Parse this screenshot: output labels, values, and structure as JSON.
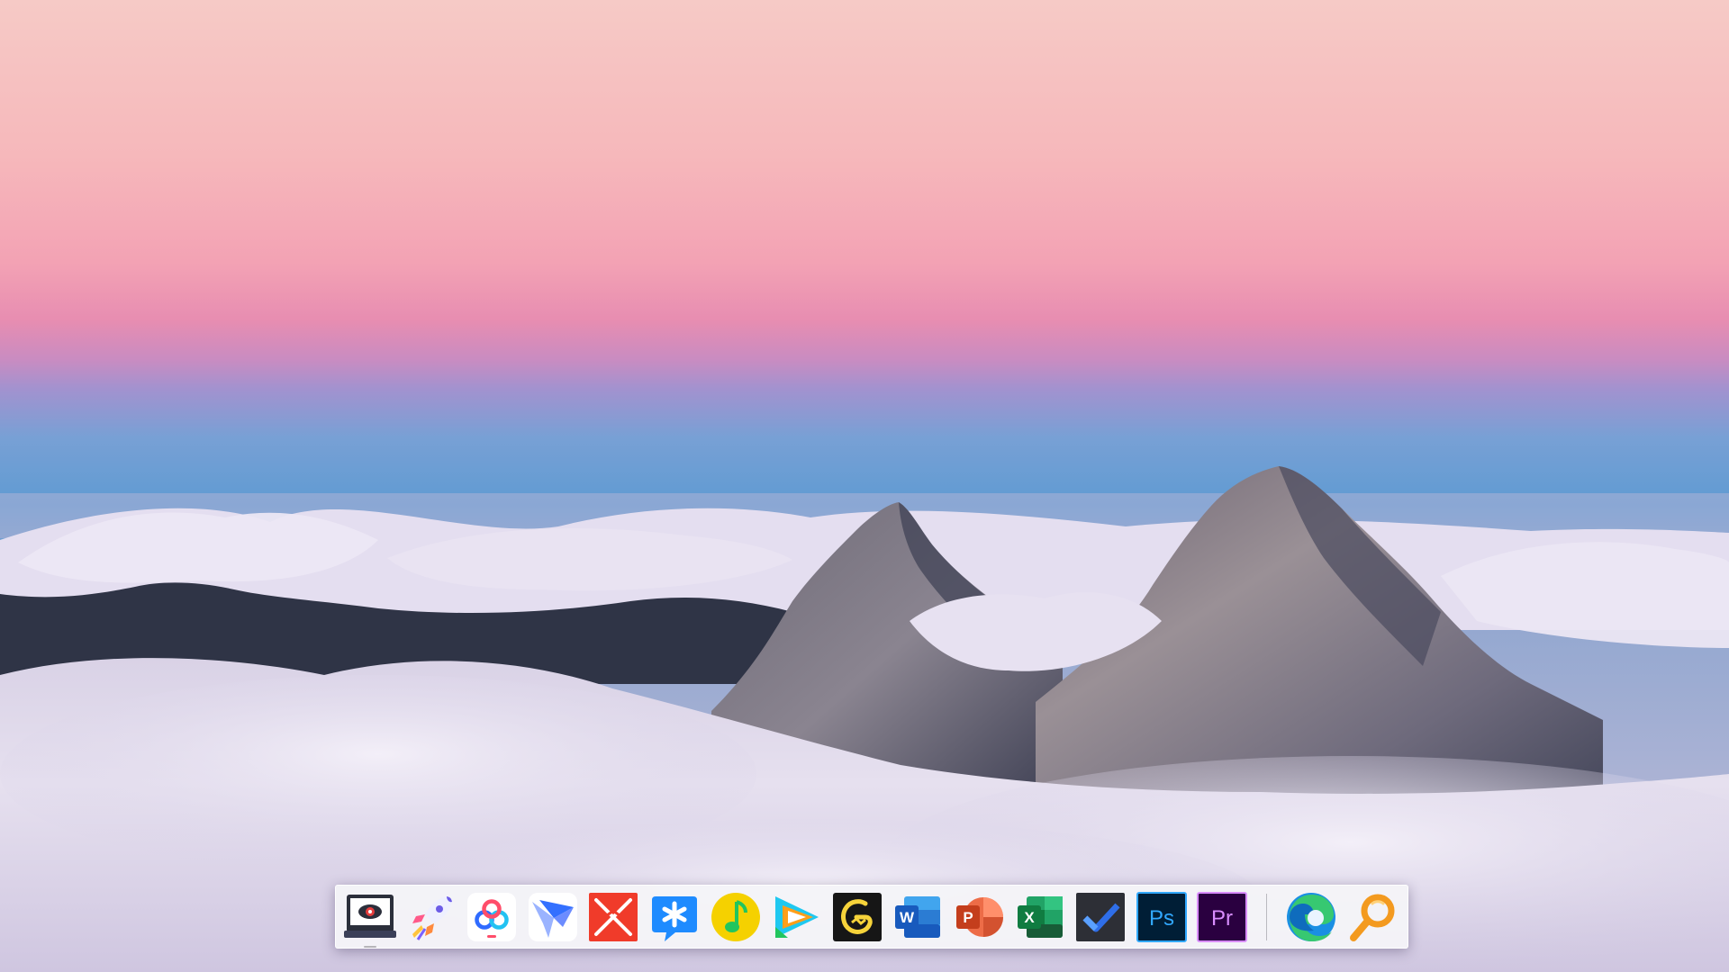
{
  "desktop": {
    "wallpaper": {
      "subject": "mountain-peaks-above-sea-of-clouds",
      "colors": {
        "sky_top": "#f6c9c6",
        "sky_pink": "#f0a0b5",
        "sky_magenta": "#d77fb0",
        "sky_purple": "#a88bcb",
        "sky_blue": "#6aa2d2",
        "sky_blue_dark": "#4f8fc8",
        "cloud": "#e7e0f0",
        "cloud_shadow": "#b9b0d2",
        "rock_light": "#8d8488",
        "rock_dark": "#3d3c4f",
        "ridge": "#2f3344"
      }
    }
  },
  "dock": {
    "background": "#f4f4f8",
    "apps": [
      {
        "icon": "screen-recorder-icon",
        "color": "#2b2f3b"
      },
      {
        "icon": "rocket-launcher-icon",
        "color": "#6c5ce7"
      },
      {
        "icon": "baidu-netdisk-icon",
        "color": "#2f6bff"
      },
      {
        "icon": "feishu-icon",
        "color": "#3370ff"
      },
      {
        "icon": "xmind-icon",
        "color": "#f03b2a"
      },
      {
        "icon": "dingtalk-icon",
        "color": "#1e8bff"
      },
      {
        "icon": "qq-music-icon",
        "color": "#f5d100"
      },
      {
        "icon": "tencent-video-icon",
        "color": "#1fc8f0"
      },
      {
        "icon": "wegame-icon",
        "color": "#f6d33a"
      },
      {
        "icon": "word-icon",
        "color": "#2b5fb8"
      },
      {
        "icon": "powerpoint-icon",
        "color": "#d04526"
      },
      {
        "icon": "excel-icon",
        "color": "#1d7a43"
      },
      {
        "icon": "microsoft-todo-icon",
        "color": "#2f6ee8"
      },
      {
        "icon": "photoshop-icon",
        "color": "#31a8ff"
      },
      {
        "icon": "premiere-pro-icon",
        "color": "#d98dff"
      },
      {
        "icon": "edge-browser-icon",
        "color": "#1a8fe3"
      },
      {
        "icon": "search-icon",
        "color": "#f39a1f"
      }
    ],
    "ps_text": "Ps",
    "pr_text": "Pr",
    "word_text": "W",
    "ppt_text": "P",
    "excel_text": "X"
  }
}
